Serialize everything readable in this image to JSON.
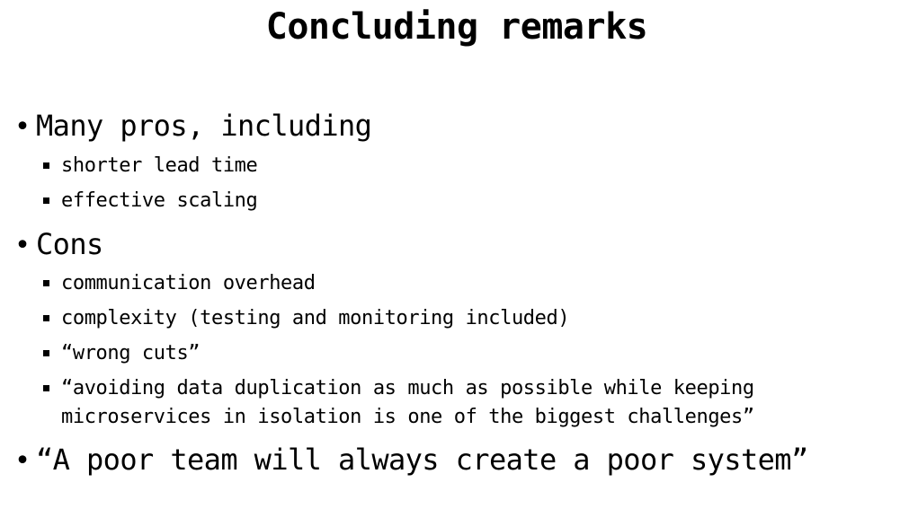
{
  "slide": {
    "title": "Concluding remarks",
    "bullets": [
      {
        "text": "Many pros, including",
        "sub": [
          "shorter lead time",
          "effective scaling"
        ]
      },
      {
        "text": "Cons",
        "sub": [
          "communication overhead",
          "complexity (testing and monitoring included)",
          "“wrong cuts”",
          "“avoiding data duplication as much as possible while keeping\nmicroservices in isolation is one of the biggest challenges”"
        ]
      },
      {
        "text": "“A poor team will always create a poor system”",
        "sub": []
      }
    ]
  }
}
